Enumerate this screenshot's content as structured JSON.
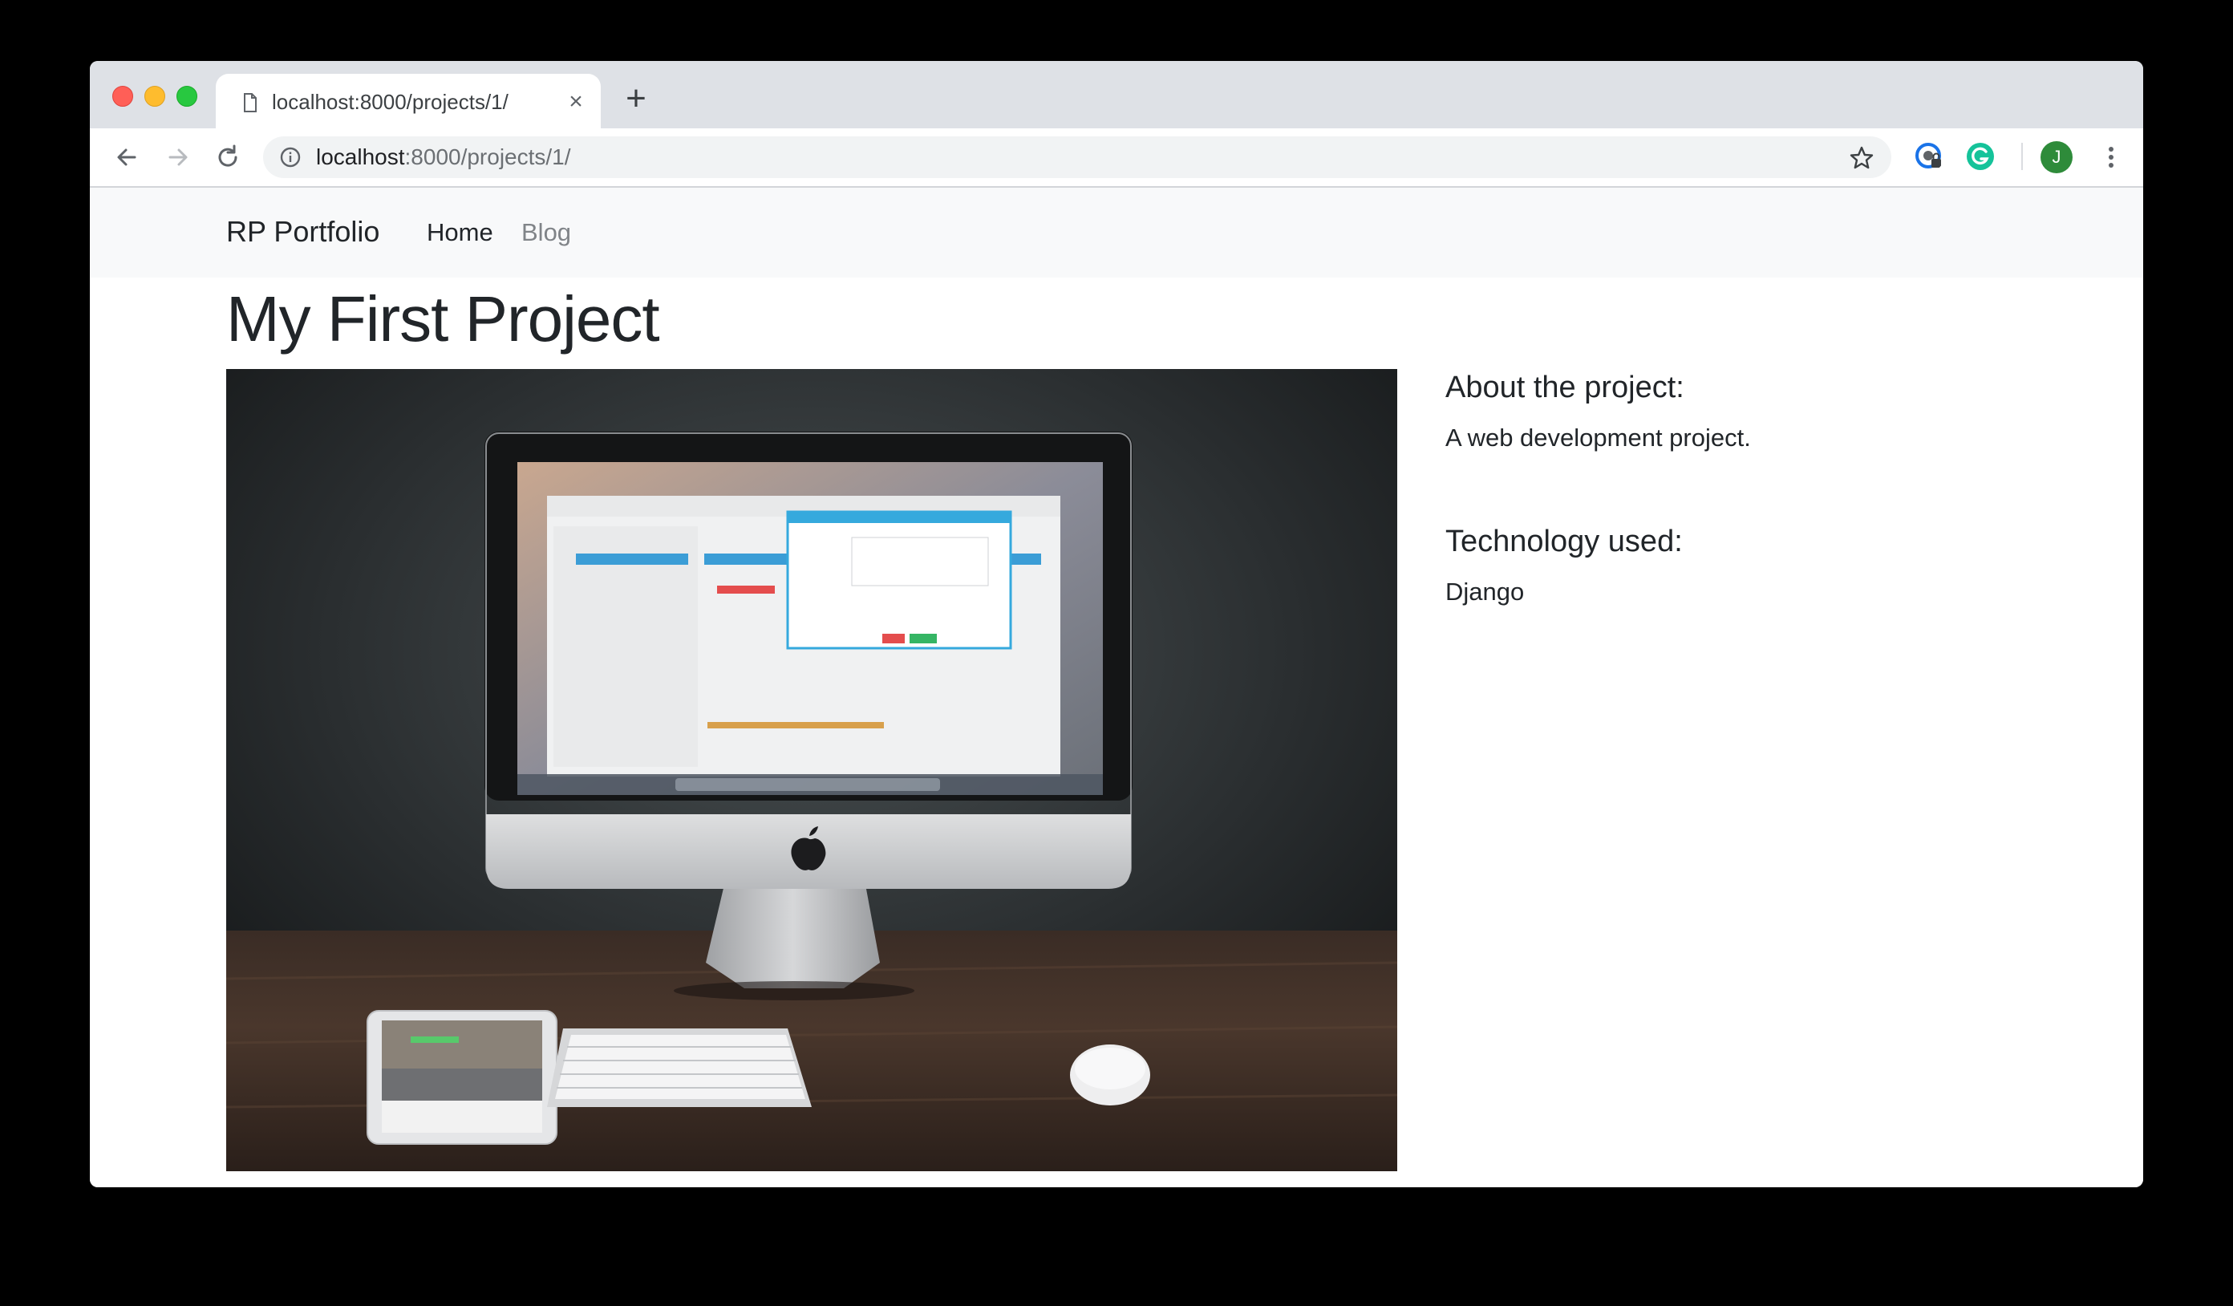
{
  "browser": {
    "tab": {
      "title": "localhost:8000/projects/1/",
      "close_symbol": "×",
      "page_icon": "document-icon"
    },
    "new_tab_symbol": "+",
    "url_host": "localhost",
    "url_path": ":8000/projects/1/",
    "profile_initial": "J",
    "icons": [
      "back-arrow-icon",
      "forward-arrow-icon",
      "reload-icon",
      "info-icon",
      "star-icon",
      "extension-lock-icon",
      "grammarly-icon",
      "menu-dots-icon"
    ],
    "colors": {
      "tabstrip": "#dee1e6",
      "omnibox": "#f1f3f4",
      "avatar": "#2e8b3a",
      "grammarly": "#15c39a"
    }
  },
  "site": {
    "brand": "RP Portfolio",
    "nav": {
      "home": "Home",
      "blog": "Blog"
    },
    "colors": {
      "navbar": "#f8f9fa",
      "text": "#212529",
      "muted": "#808488"
    }
  },
  "project": {
    "title": "My First Project",
    "about_heading": "About the project:",
    "about_text": "A web development project.",
    "tech_heading": "Technology used:",
    "tech_text": "Django",
    "image_description": "photo-imac-ipad-keyboard-mouse-on-desk"
  }
}
